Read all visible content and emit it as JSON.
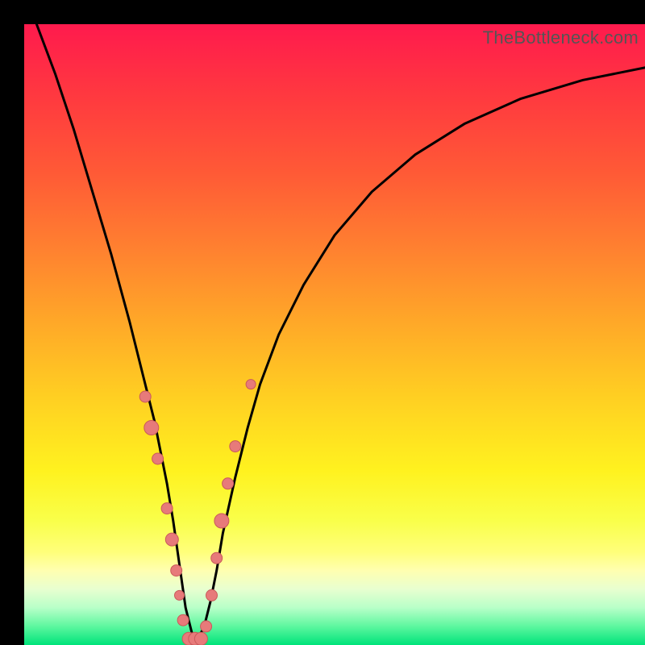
{
  "watermark": "TheBottleneck.com",
  "colors": {
    "curve": "#000000",
    "marker_fill": "#e77a7a",
    "marker_stroke": "#c95a5a",
    "background_black": "#000000"
  },
  "chart_data": {
    "type": "line",
    "title": "",
    "xlabel": "",
    "ylabel": "",
    "xlim": [
      0,
      100
    ],
    "ylim": [
      0,
      100
    ],
    "grid": false,
    "legend": false,
    "annotations": [
      "TheBottleneck.com"
    ],
    "series": [
      {
        "name": "bottleneck-curve",
        "comment": "V-shaped curve; y≈100 at edges, y≈0 near x≈27; values estimated from pixel positions on a 0–100 normalized axis.",
        "x": [
          2,
          5,
          8,
          11,
          14,
          17,
          19,
          21,
          23,
          24,
          25,
          26,
          27,
          28,
          29,
          30,
          31,
          32,
          34,
          36,
          38,
          41,
          45,
          50,
          56,
          63,
          71,
          80,
          90,
          100
        ],
        "y": [
          100,
          92,
          83,
          73,
          63,
          52,
          44,
          36,
          26,
          20,
          13,
          6,
          2,
          1,
          3,
          7,
          12,
          18,
          27,
          35,
          42,
          50,
          58,
          66,
          73,
          79,
          84,
          88,
          91,
          93
        ]
      }
    ],
    "markers": {
      "comment": "Salmon pill/dot markers clustered along lower portion of the V; (x,y) on same 0–100 normalized scale, size in px approx.",
      "points": [
        {
          "x": 19.5,
          "y": 40,
          "size": 14
        },
        {
          "x": 20.5,
          "y": 35,
          "size": 18
        },
        {
          "x": 21.5,
          "y": 30,
          "size": 14
        },
        {
          "x": 23.0,
          "y": 22,
          "size": 14
        },
        {
          "x": 23.8,
          "y": 17,
          "size": 16
        },
        {
          "x": 24.5,
          "y": 12,
          "size": 14
        },
        {
          "x": 25.0,
          "y": 8,
          "size": 12
        },
        {
          "x": 25.6,
          "y": 4,
          "size": 14
        },
        {
          "x": 26.5,
          "y": 1,
          "size": 16
        },
        {
          "x": 27.5,
          "y": 1,
          "size": 16
        },
        {
          "x": 28.5,
          "y": 1,
          "size": 16
        },
        {
          "x": 29.3,
          "y": 3,
          "size": 14
        },
        {
          "x": 30.2,
          "y": 8,
          "size": 14
        },
        {
          "x": 31.0,
          "y": 14,
          "size": 14
        },
        {
          "x": 31.8,
          "y": 20,
          "size": 18
        },
        {
          "x": 32.8,
          "y": 26,
          "size": 14
        },
        {
          "x": 34.0,
          "y": 32,
          "size": 14
        },
        {
          "x": 36.5,
          "y": 42,
          "size": 12
        }
      ]
    }
  }
}
